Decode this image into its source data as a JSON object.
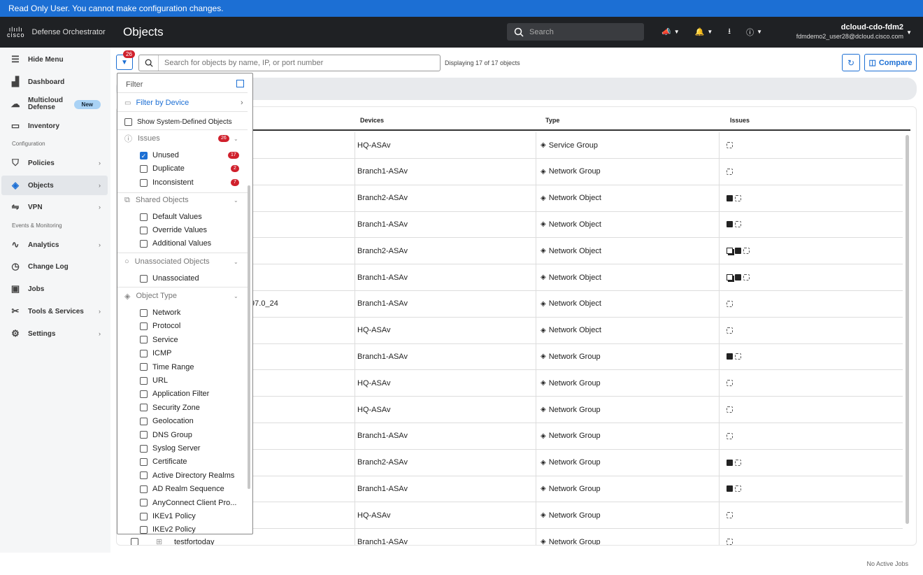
{
  "banner": {
    "text": "Read Only User. You cannot make configuration changes."
  },
  "header": {
    "brand_mark": "cisco",
    "app_name": "Defense Orchestrator",
    "page_title": "Objects",
    "search_placeholder": "Search",
    "user_name": "dcloud-cdo-fdm2",
    "user_email": "fdmdemo2_user28@dcloud.cisco.com"
  },
  "sidebar": {
    "hide_menu": "Hide Menu",
    "dashboard": "Dashboard",
    "multicloud": "Multicloud Defense",
    "multicloud_badge": "New",
    "inventory": "Inventory",
    "section_config": "Configuration",
    "policies": "Policies",
    "objects": "Objects",
    "vpn": "VPN",
    "section_events": "Events & Monitoring",
    "analytics": "Analytics",
    "change_log": "Change Log",
    "jobs": "Jobs",
    "tools": "Tools & Services",
    "settings": "Settings"
  },
  "toolbar": {
    "filter_count": "26",
    "search_placeholder": "Search for objects by name, IP, or port number",
    "displaying": "Displaying 17 of 17 objects",
    "compare_label": "Compare"
  },
  "table": {
    "headers": {
      "devices": "Devices",
      "type": "Type",
      "issues": "Issues"
    },
    "rows": [
      {
        "name": "",
        "device": "HQ-ASAv",
        "type": "Service Group",
        "issues": [
          "dash"
        ]
      },
      {
        "name": "",
        "device": "Branch1-ASAv",
        "type": "Network Group",
        "issues": [
          "dash"
        ]
      },
      {
        "name": "",
        "device": "Branch2-ASAv",
        "type": "Network Object",
        "issues": [
          "solid",
          "dash"
        ]
      },
      {
        "name": "",
        "device": "Branch1-ASAv",
        "type": "Network Object",
        "issues": [
          "solid",
          "dash"
        ]
      },
      {
        "name": "",
        "device": "Branch2-ASAv",
        "type": "Network Object",
        "issues": [
          "dbl",
          "solid",
          "dash"
        ]
      },
      {
        "name": "",
        "device": "Branch1-ASAv",
        "type": "Network Object",
        "issues": [
          "dbl",
          "solid",
          "dash"
        ]
      },
      {
        "name": ".97.0_24",
        "device": "Branch1-ASAv",
        "type": "Network Object",
        "issues": [
          "dash"
        ]
      },
      {
        "name": "",
        "device": "HQ-ASAv",
        "type": "Network Object",
        "issues": [
          "dash"
        ]
      },
      {
        "name": "",
        "device": "Branch1-ASAv",
        "type": "Network Group",
        "issues": [
          "solid",
          "dash"
        ]
      },
      {
        "name": "",
        "device": "HQ-ASAv",
        "type": "Network Group",
        "issues": [
          "dash"
        ]
      },
      {
        "name": "",
        "device": "HQ-ASAv",
        "type": "Network Group",
        "issues": [
          "dash"
        ]
      },
      {
        "name": "",
        "device": "Branch1-ASAv",
        "type": "Network Group",
        "issues": [
          "dash"
        ]
      },
      {
        "name": "",
        "device": "Branch2-ASAv",
        "type": "Network Group",
        "issues": [
          "solid",
          "dash"
        ]
      },
      {
        "name": "",
        "device": "Branch1-ASAv",
        "type": "Network Group",
        "issues": [
          "solid",
          "dash"
        ]
      },
      {
        "name": "",
        "device": "HQ-ASAv",
        "type": "Network Group",
        "issues": [
          "dash"
        ]
      },
      {
        "name": "testfortoday",
        "device": "Branch1-ASAv",
        "type": "Network Group",
        "issues": [
          "dash"
        ]
      }
    ]
  },
  "filter": {
    "title": "Filter",
    "filter_by_device": "Filter by Device",
    "show_system": "Show System-Defined Objects",
    "issues_label": "Issues",
    "issues_count": "26",
    "unused": "Unused",
    "unused_count": "17",
    "duplicate": "Duplicate",
    "duplicate_count": "2",
    "inconsistent": "Inconsistent",
    "inconsistent_count": "7",
    "shared_label": "Shared Objects",
    "default_values": "Default Values",
    "override_values": "Override Values",
    "additional_values": "Additional Values",
    "unassociated_label": "Unassociated Objects",
    "unassociated": "Unassociated",
    "object_type_label": "Object Type",
    "types": [
      "Network",
      "Protocol",
      "Service",
      "ICMP",
      "Time Range",
      "URL",
      "Application Filter",
      "Security Zone",
      "Geolocation",
      "DNS Group",
      "Syslog Server",
      "Certificate",
      "Active Directory Realms",
      "AD Realm Sequence",
      "AnyConnect Client Pro...",
      "IKEv1 Policy",
      "IKEv2 Policy"
    ]
  },
  "status": {
    "jobs": "No Active Jobs"
  }
}
